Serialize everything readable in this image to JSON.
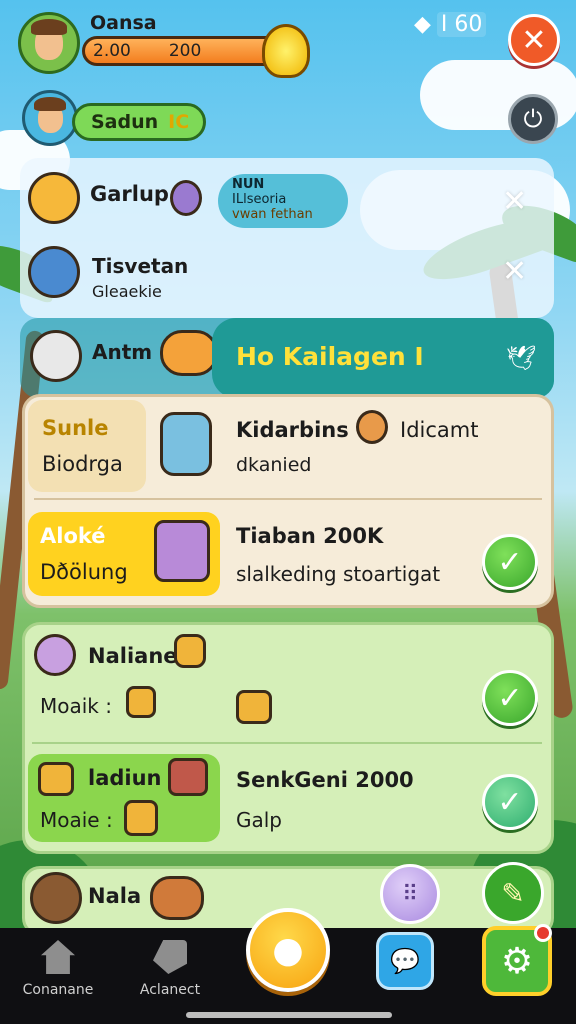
{
  "top_bar": {
    "player_name": "Oansa",
    "resource_left": "2.00",
    "resource_right": "200",
    "battery_text": "I 60",
    "close_glyph": "✕",
    "second_label": "Sadun",
    "second_badge": "IC",
    "power_glyph": "⏻"
  },
  "rows": {
    "row1_name": "Garlup",
    "info_title": "NUN",
    "info_line1": "ILlseoria",
    "info_line2": "vwan fethan",
    "row2_name": "Tisvetan",
    "row2_sub": "Gleaekie",
    "row3_name": "Antm",
    "banner": "Ho Kailagen I"
  },
  "quests": {
    "q1_tab_title": "Sunle",
    "q1_tab_sub": "Biodrga",
    "q1_title": "Kidarbins",
    "q1_extra": "Idicamt",
    "q1_sub": "dkanied",
    "q2_tab_title": "Aloké",
    "q2_tab_sub": "Dðölung",
    "q2_title": "Tiaban 200K",
    "q2_sub": "slalkeding stoartigat",
    "q3_name": "Naliane",
    "q3_sub": "Moaik :",
    "q4_tab_title": "ladiun",
    "q4_tab_sub": "Moaie :",
    "q4_title": "SenkGeni 2000",
    "q4_sub": "Galp",
    "q5_name": "Nala"
  },
  "nav": {
    "home_label": "Conanane",
    "second_label": "Aclanect"
  },
  "icons": {
    "x_glyph": "✕",
    "check_glyph": "✓",
    "bird_glyph": "🕊",
    "dots_glyph": "⠿",
    "chat_glyph": "💬",
    "gear_glyph": "⚙",
    "center_glyph": "●"
  }
}
